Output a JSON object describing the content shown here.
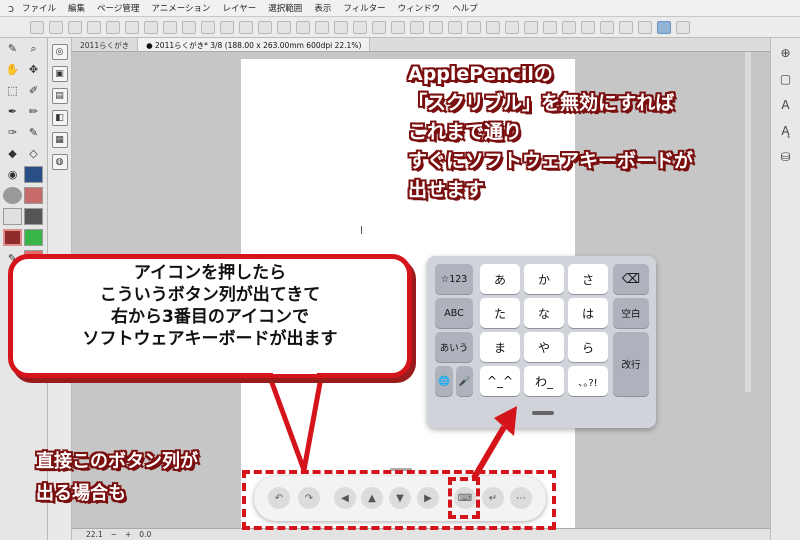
{
  "menu": {
    "items": [
      "ファイル",
      "編集",
      "ページ管理",
      "アニメーション",
      "レイヤー",
      "選択範囲",
      "表示",
      "フィルター",
      "ウィンドウ",
      "ヘルプ"
    ]
  },
  "tabs": [
    {
      "label": "2011らくがき"
    },
    {
      "label": "● 2011らくがき* 3/8 (188.00 x 263.00mm 600dpi 22.1%)"
    }
  ],
  "status": {
    "zoom": "22.1",
    "minus": "−",
    "plus": "+",
    "angle": "0.0"
  },
  "annotations": {
    "top_right": [
      "ApplePencilの",
      "「スクリブル」を無効にすれば",
      "これまで通り",
      "すぐにソフトウェアキーボードが",
      "出せます"
    ],
    "bubble": [
      "アイコンを押したら",
      "こういうボタン列が出てきて",
      "右から3番目のアイコンで",
      "ソフトウェアキーボードが出ます"
    ],
    "bottom_left": [
      "直接このボタン列が",
      "出る場合も"
    ]
  },
  "keyboard": {
    "left_col": [
      "☆123",
      "ABC",
      "あいう"
    ],
    "globe": "🌐",
    "mic": "🎤",
    "main": [
      [
        "あ",
        "か",
        "さ"
      ],
      [
        "た",
        "な",
        "は"
      ],
      [
        "ま",
        "や",
        "ら"
      ],
      [
        "^_^",
        "わ_",
        "､｡?!"
      ]
    ],
    "delete": "⌫",
    "space": "空白",
    "enter": "改行"
  },
  "palette": {
    "undo": "↶",
    "redo": "↷",
    "left": "◀",
    "up": "▲",
    "down": "▼",
    "right": "▶",
    "keyboard": "⌨",
    "return": "↵",
    "more": "⋯"
  },
  "colors": {
    "accent_red": "#d4141a",
    "shadow_red": "#7a0f0f"
  }
}
